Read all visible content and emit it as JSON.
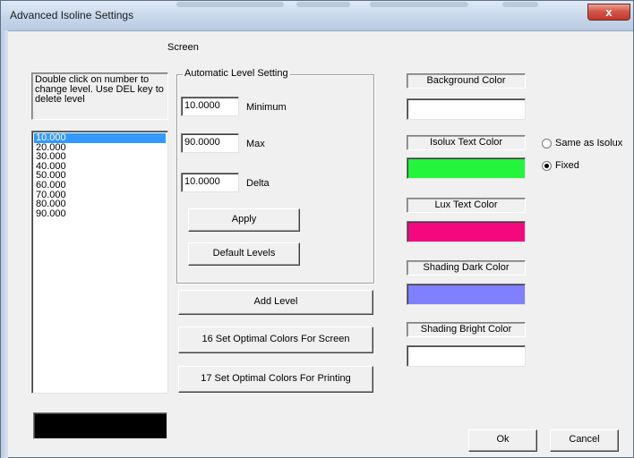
{
  "window": {
    "title": "Advanced Isoline Settings",
    "close_label": "x"
  },
  "screen_label": "Screen",
  "instructions": "Double click on number to change level. Use DEL key to delete level",
  "levels": [
    "10.000",
    "20.000",
    "30.000",
    "40.000",
    "50.000",
    "60.000",
    "70.000",
    "80.000",
    "90.000"
  ],
  "automatic": {
    "group_label": "Automatic Level Setting",
    "minimum_value": "10.0000",
    "minimum_label": "Minimum",
    "max_value": "90.0000",
    "max_label": "Max",
    "delta_value": "10.0000",
    "delta_label": "Delta",
    "apply_label": "Apply",
    "default_levels_label": "Default Levels"
  },
  "buttons": {
    "add_level": "Add Level",
    "optimal_screen": "16 Set Optimal Colors For Screen",
    "optimal_printing": "17 Set Optimal Colors For Printing",
    "ok": "Ok",
    "cancel": "Cancel"
  },
  "colors": {
    "background": {
      "label": "Background Color",
      "color": "#ffffff"
    },
    "isolux_text": {
      "label": "Isolux Text Color",
      "color": "#22f53b"
    },
    "lux_text": {
      "label": "Lux Text Color",
      "color": "#f5077e"
    },
    "shading_dark": {
      "label": "Shading Dark Color",
      "color": "#7f80ff"
    },
    "shading_bright": {
      "label": "Shading Bright Color",
      "color": "#ffffff"
    },
    "bottom_swatch": "#000000"
  },
  "isolux_mode": {
    "options": [
      "Same as Isolux",
      "Fixed"
    ],
    "selected": "Fixed"
  }
}
